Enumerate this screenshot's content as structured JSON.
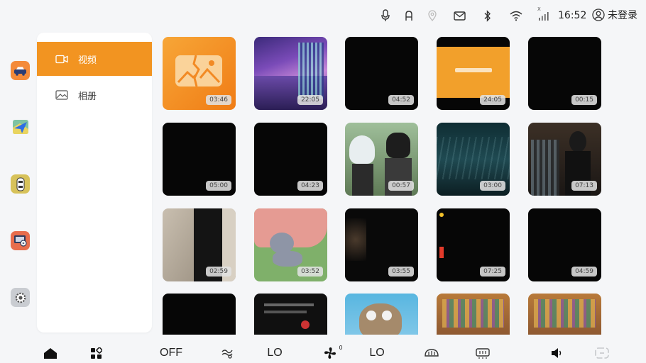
{
  "status_bar": {
    "icons": [
      "microphone-icon",
      "seat-icon",
      "location-icon",
      "mail-icon",
      "bluetooth-icon",
      "wifi-icon",
      "signal-icon"
    ],
    "signal_label": "X",
    "time": "16:52",
    "login_label": "未登录"
  },
  "dock": {
    "apps": [
      "car-app-icon",
      "navigation-app-icon",
      "vehicle-app-icon",
      "media-app-icon",
      "settings-app-icon"
    ]
  },
  "side_panel": {
    "items": [
      {
        "label": "视频",
        "icon": "video-icon",
        "active": true
      },
      {
        "label": "相册",
        "icon": "photo-album-icon",
        "active": false
      }
    ],
    "accent_color": "#f29421"
  },
  "videos": [
    {
      "duration": "03:46"
    },
    {
      "duration": "22:05"
    },
    {
      "duration": "04:52"
    },
    {
      "duration": "24:05"
    },
    {
      "duration": "00:15"
    },
    {
      "duration": "05:00"
    },
    {
      "duration": "04:23"
    },
    {
      "duration": "00:57"
    },
    {
      "duration": "03:00"
    },
    {
      "duration": "07:13"
    },
    {
      "duration": "02:59"
    },
    {
      "duration": "03:52"
    },
    {
      "duration": "03:55"
    },
    {
      "duration": "07:25"
    },
    {
      "duration": "04:59"
    },
    {
      "duration": ""
    },
    {
      "duration": ""
    },
    {
      "duration": ""
    },
    {
      "duration": ""
    },
    {
      "duration": ""
    }
  ],
  "bottom_bar": {
    "home_icon": "home-icon",
    "apps_icon": "apps-grid-icon",
    "ac_status": "OFF",
    "airflow_icon": "airflow-icon",
    "left_temp": "LO",
    "fan_icon": "fan-icon",
    "fan_level": "0",
    "right_temp": "LO",
    "front_defrost_icon": "front-defrost-icon",
    "rear_defrost_icon": "rear-defrost-icon",
    "volume_icon": "volume-icon",
    "connect_icon": "connect-icon"
  }
}
